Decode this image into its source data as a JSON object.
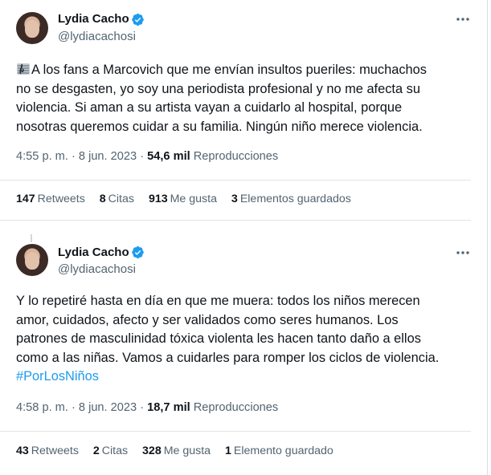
{
  "tweets": [
    {
      "author": {
        "name": "Lydia Cacho",
        "handle": "@lydiacachosi"
      },
      "text_lines": [
        "A los fans a Marcovich que me envían insultos pueriles: muchachos",
        "no se desgasten, yo soy una periodista profesional y no me afecta su",
        "violencia. Si aman a su artista vayan a cuidarlo al hospital, porque",
        "nosotras queremos cuidar a su familia. Ningún niño merece violencia."
      ],
      "meta": {
        "time": "4:55 p. m.",
        "date": "8 jun. 2023",
        "views": "54,6 mil",
        "views_label": "Reproducciones"
      },
      "stats": {
        "retweets": "147",
        "retweets_label": "Retweets",
        "quotes": "8",
        "quotes_label": "Citas",
        "likes": "913",
        "likes_label": "Me gusta",
        "bookmarks": "3",
        "bookmarks_label": "Elementos guardados"
      }
    },
    {
      "author": {
        "name": "Lydia Cacho",
        "handle": "@lydiacachosi"
      },
      "text_lines": [
        "Y lo repetiré hasta en día en que me muera: todos los niños merecen",
        "amor, cuidados, afecto y ser validados como seres humanos. Los",
        "patrones de masculinidad tóxica violenta  les hacen tanto daño a ellos",
        "como a las niñas. Vamos a cuidarles para romper los ciclos de violencia."
      ],
      "hashtag": "#PorLosNiños",
      "meta": {
        "time": "4:58 p. m.",
        "date": "8 jun. 2023",
        "views": "18,7 mil",
        "views_label": "Reproducciones"
      },
      "stats": {
        "retweets": "43",
        "retweets_label": "Retweets",
        "quotes": "2",
        "quotes_label": "Citas",
        "likes": "328",
        "likes_label": "Me gusta",
        "bookmarks": "1",
        "bookmarks_label": "Elemento guardado"
      }
    }
  ],
  "icons": {
    "verified": "verified-badge-icon",
    "more": "more-options-icon",
    "emoji": "musical-score-emoji-icon"
  },
  "colors": {
    "accent": "#1d9bf0",
    "text": "#0f1419",
    "secondary": "#536471"
  },
  "separators": {
    "dot": "·"
  }
}
